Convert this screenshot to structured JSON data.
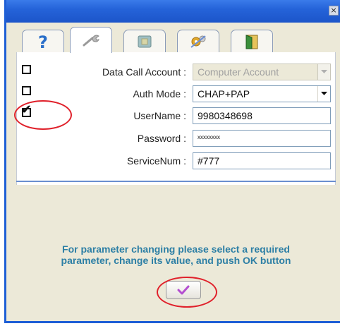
{
  "window": {
    "close_glyph": "×"
  },
  "tabs": [
    {
      "name": "help-tab",
      "icon": "question-icon"
    },
    {
      "name": "settings-tab",
      "icon": "wrench-icon"
    },
    {
      "name": "sim-tab",
      "icon": "sim-card-icon"
    },
    {
      "name": "tools-tab",
      "icon": "gear-icon"
    },
    {
      "name": "door-tab",
      "icon": "door-icon"
    }
  ],
  "form": {
    "data_call_account": {
      "label": "Data Call Account :",
      "value": "Computer Account",
      "checked": false,
      "enabled": false
    },
    "auth_mode": {
      "label": "Auth Mode :",
      "value": "CHAP+PAP",
      "checked": false,
      "enabled": true
    },
    "username": {
      "label": "UserName :",
      "value": "9980348698",
      "checked": true,
      "enabled": true
    },
    "password": {
      "label": "Password :",
      "value": "xxxxxxxx",
      "enabled": true
    },
    "service_num": {
      "label": "ServiceNum :",
      "value": "#777",
      "enabled": true
    }
  },
  "hint": {
    "line1": "For parameter changing please select a required",
    "line2": "parameter, change its value, and push OK button"
  },
  "ok_button": {
    "icon": "checkmark-icon"
  },
  "colors": {
    "title_bar": "#2563d9",
    "hint_text": "#2d7fa5",
    "annotation_ring": "#e0212b",
    "ok_check": "#b44fd0"
  }
}
